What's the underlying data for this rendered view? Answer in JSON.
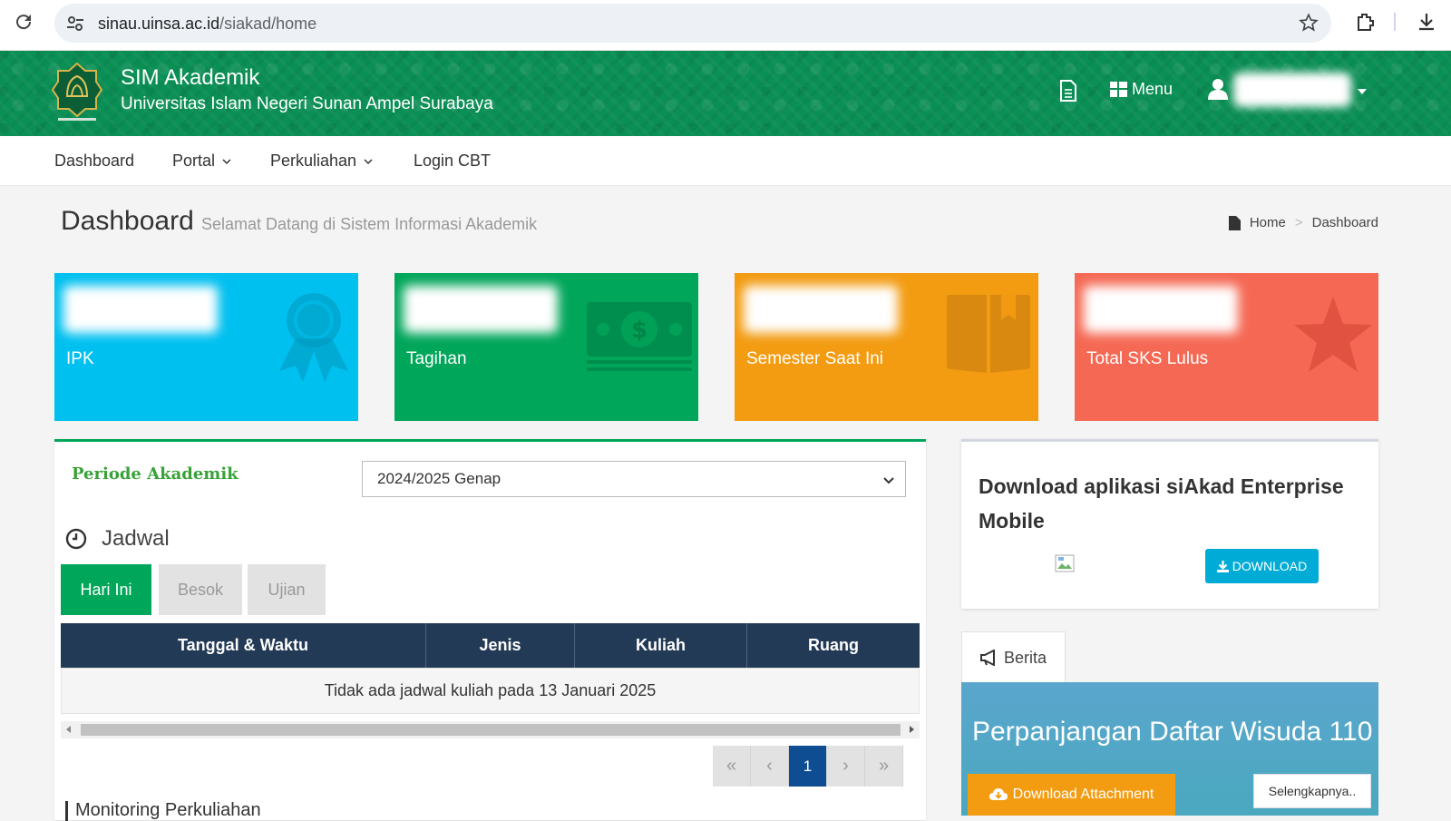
{
  "browser": {
    "url_host": "sinau.uinsa.ac.id",
    "url_path": "/siakad/home"
  },
  "header": {
    "title": "SIM Akademik",
    "subtitle": "Universitas Islam Negeri Sunan Ampel Surabaya",
    "menu_label": "Menu",
    "user_name": "",
    "brand_color": "#0a8f55"
  },
  "nav": {
    "items": [
      {
        "label": "Dashboard"
      },
      {
        "label": "Portal",
        "icon": "chevron-down-icon"
      },
      {
        "label": "Perkuliahan",
        "icon": "chevron-down-icon"
      },
      {
        "label": "Login CBT"
      }
    ]
  },
  "page": {
    "title": "Dashboard",
    "subtitle": "Selamat Datang di Sistem Informasi Akademik",
    "breadcrumb": [
      "Home",
      "Dashboard"
    ]
  },
  "stats": [
    {
      "label": "IPK",
      "value": "",
      "color": "#00c0ef",
      "icon": "ribbon-icon"
    },
    {
      "label": "Tagihan",
      "value": "",
      "color": "#00a65a",
      "icon": "money-icon"
    },
    {
      "label": "Semester Saat Ini",
      "value": "",
      "color": "#f39c12",
      "icon": "book-icon"
    },
    {
      "label": "Total SKS Lulus",
      "value": "",
      "color": "#f56954",
      "icon": "star-icon"
    }
  ],
  "periode": {
    "label": "Periode Akademik",
    "selected": "2024/2025 Genap"
  },
  "jadwal": {
    "title": "Jadwal",
    "tabs": [
      {
        "label": "Hari Ini",
        "active": true
      },
      {
        "label": "Besok",
        "active": false
      },
      {
        "label": "Ujian",
        "active": false
      }
    ],
    "columns": [
      "Tanggal & Waktu",
      "Jenis",
      "Kuliah",
      "Ruang"
    ],
    "empty_message": "Tidak ada jadwal kuliah pada 13 Januari 2025",
    "pagination": {
      "first": "«",
      "prev": "‹",
      "current": "1",
      "next": "›",
      "last": "»"
    },
    "next_section_partial": "Monitoring Perkuliahan"
  },
  "download_app": {
    "title": "Download aplikasi siAkad Enterprise Mobile",
    "button_label": "DOWNLOAD"
  },
  "berita": {
    "tab_label": "Berita",
    "headline": "Perpanjangan Daftar Wisuda 110",
    "attachment_label": "Download Attachment",
    "more_label": "Selengkapnya.."
  }
}
